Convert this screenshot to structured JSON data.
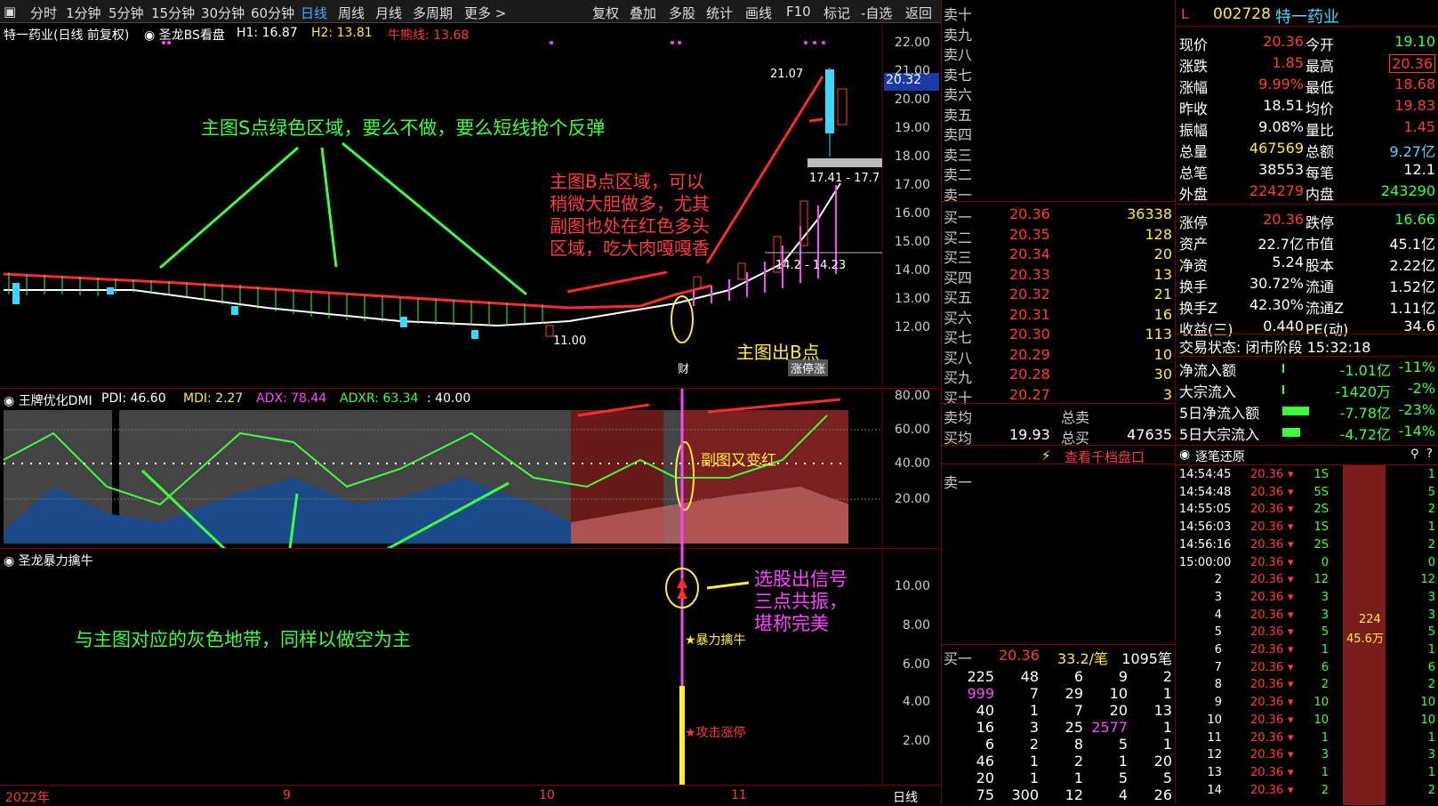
{
  "toolbar": {
    "items": [
      "分时",
      "1分钟",
      "5分钟",
      "15分钟",
      "30分钟",
      "60分钟",
      "日线",
      "周线",
      "月线",
      "多周期",
      "更多 >"
    ],
    "active": "日线",
    "right_items": [
      "复权",
      "叠加",
      "多股",
      "统计",
      "画线",
      "F10",
      "标记",
      "-自选",
      "返回"
    ]
  },
  "main_chart": {
    "title": "特一药业(日线 前复权)",
    "indicator": "圣龙BS看盘",
    "h1": "H1: 16.87",
    "h2": "H2: 13.81",
    "bull_line": "牛熊线: 13.68",
    "yticks": [
      "22.00",
      "21.00",
      "20.00",
      "19.00",
      "18.00",
      "17.00",
      "16.00",
      "15.00",
      "14.00",
      "13.00",
      "12.00"
    ],
    "price_tag": "20.32",
    "high_label": "21.07",
    "range_label": "17.41 - 17.7",
    "range_label2": "14.2 - 14.23",
    "low_label": "11.00",
    "zhangting_tag": "涨停",
    "yu_tag": "财",
    "zhang_tag": "涨停涨"
  },
  "annotations": {
    "s_region": "主图S点绿色区域，要么不做，要么短线抢个反弹",
    "b_region": [
      "主图B点区域，可以",
      "稍微大胆做多，尤其",
      "副图也处在红色多头",
      "区域，吃大肉嘎嘎香"
    ],
    "b_point": "主图出B点",
    "sub_red": "副图又变红",
    "gray_band": "与主图对应的灰色地带，同样以做空为主",
    "signal": [
      "选股出信号",
      "三点共振，",
      "堪称完美"
    ],
    "bao_li": "★暴力擒牛",
    "gong_ji": "★攻击涨停"
  },
  "ind1": {
    "name": "王牌优化DMI",
    "pdi": "PDI: 46.60",
    "mdi": "MDI: 2.27",
    "adx": "ADX: 78.44",
    "adxr": "ADXR: 63.34",
    "extra": ": 40.00",
    "yticks": [
      "80.00",
      "60.00",
      "40.00",
      "20.00"
    ]
  },
  "ind2": {
    "name": "圣龙暴力擒牛",
    "yticks": [
      "10.00",
      "8.00",
      "6.00",
      "4.00",
      "2.00"
    ]
  },
  "xaxis": {
    "labels": [
      "2022年",
      "9",
      "10",
      "11"
    ],
    "period": "日线"
  },
  "order_book": {
    "sells": [
      "卖十",
      "卖九",
      "卖八",
      "卖七",
      "卖六",
      "卖五",
      "卖四",
      "卖三",
      "卖二",
      "卖一"
    ],
    "buys": [
      [
        "买一",
        "20.36",
        "36338"
      ],
      [
        "买二",
        "20.35",
        "128"
      ],
      [
        "买三",
        "20.34",
        "20"
      ],
      [
        "买四",
        "20.33",
        "13"
      ],
      [
        "买五",
        "20.32",
        "21"
      ],
      [
        "买六",
        "20.31",
        "16"
      ],
      [
        "买七",
        "20.30",
        "113"
      ],
      [
        "买八",
        "20.29",
        "10"
      ],
      [
        "买九",
        "20.28",
        "30"
      ],
      [
        "买十",
        "20.27",
        "3"
      ]
    ],
    "sell_avg": "卖均",
    "total_sell": "总卖",
    "buy_avg": "买均",
    "buy_avg_val": "19.93",
    "total_buy": "总买",
    "total_buy_val": "47635",
    "link": "查看千档盘口",
    "sell1_label": "卖一",
    "buy1_label": "买一",
    "buy1_price": "20.36",
    "per_order": "33.2/笔",
    "order_count": "1095笔",
    "queue": [
      [
        "225",
        "48",
        "6",
        "9",
        "2"
      ],
      [
        "999",
        "7",
        "29",
        "10",
        "1"
      ],
      [
        "40",
        "1",
        "7",
        "20",
        "13"
      ],
      [
        "16",
        "3",
        "25",
        "2577",
        "1"
      ],
      [
        "6",
        "2",
        "8",
        "5",
        "1"
      ],
      [
        "46",
        "1",
        "2",
        "1",
        "20"
      ],
      [
        "20",
        "1",
        "1",
        "5",
        "5"
      ],
      [
        "75",
        "300",
        "12",
        "4",
        "26"
      ]
    ]
  },
  "quote": {
    "marker": "L",
    "code": "002728",
    "name": "特一药业",
    "rows": [
      [
        "现价",
        "20.36",
        "今开",
        "19.10"
      ],
      [
        "涨跌",
        "1.85",
        "最高",
        "20.36"
      ],
      [
        "涨幅",
        "9.99%",
        "最低",
        "18.68"
      ],
      [
        "昨收",
        "18.51",
        "均价",
        "19.83"
      ],
      [
        "振幅",
        "9.08%",
        "量比",
        "1.45"
      ],
      [
        "总量",
        "467569",
        "总额",
        "9.27亿"
      ],
      [
        "总笔",
        "38553",
        "每笔",
        "12.1"
      ],
      [
        "外盘",
        "224279",
        "内盘",
        "243290"
      ],
      [
        "涨停",
        "20.36",
        "跌停",
        "16.66"
      ],
      [
        "资产",
        "22.7亿",
        "市值",
        "45.1亿"
      ],
      [
        "净资",
        "5.24",
        "股本",
        "2.22亿"
      ],
      [
        "换手",
        "30.72%",
        "流通",
        "1.52亿"
      ],
      [
        "换手Z",
        "42.30%",
        "流通Z",
        "1.11亿"
      ],
      [
        "收益(三)",
        "0.440",
        "PE(动)",
        "34.6"
      ]
    ],
    "status": "交易状态: 闭市阶段 15:32:18",
    "flows": [
      [
        "净流入额",
        "-1.01亿",
        "-11%"
      ],
      [
        "大宗流入",
        "-1420万",
        "-2%"
      ],
      [
        "5日净流入额",
        "-7.78亿",
        "-23%"
      ],
      [
        "5日大宗流入",
        "-4.72亿",
        "-14%"
      ]
    ]
  },
  "ticks": {
    "title": "逐笔还原",
    "rows": [
      [
        "14:54:45",
        "20.36",
        "1S",
        "1"
      ],
      [
        "14:54:48",
        "20.36",
        "5S",
        "5"
      ],
      [
        "14:55:05",
        "20.36",
        "2S",
        "2"
      ],
      [
        "14:56:03",
        "20.36",
        "1S",
        "1"
      ],
      [
        "14:56:16",
        "20.36",
        "2S",
        "2"
      ],
      [
        "15:00:00",
        "20.36",
        "0",
        "0"
      ],
      [
        "2",
        "20.36",
        "12",
        "12"
      ],
      [
        "3",
        "20.36",
        "3",
        "3"
      ],
      [
        "4",
        "20.36",
        "3",
        "3"
      ],
      [
        "5",
        "20.36",
        "5",
        "5"
      ],
      [
        "6",
        "20.36",
        "1",
        "1"
      ],
      [
        "7",
        "20.36",
        "6",
        "6"
      ],
      [
        "8",
        "20.36",
        "2",
        "2"
      ],
      [
        "9",
        "20.36",
        "10",
        "10"
      ],
      [
        "10",
        "20.36",
        "10",
        "10"
      ],
      [
        "11",
        "20.36",
        "1",
        "1"
      ],
      [
        "12",
        "20.36",
        "3",
        "3"
      ],
      [
        "13",
        "20.36",
        "1",
        "1"
      ],
      [
        "14",
        "20.36",
        "2",
        "2"
      ]
    ],
    "bar_val": "224",
    "bar_val2": "45.6万"
  },
  "colors": {
    "up": "#ff3b3b",
    "down": "#3dff3d",
    "accent": "#4aa8ff"
  }
}
